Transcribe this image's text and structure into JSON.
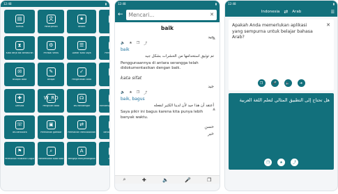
{
  "colors": {
    "accent": "#12707c"
  },
  "status": {
    "time": "12:48"
  },
  "grid": {
    "tiles": [
      {
        "label": "Kamus",
        "icon": "book-icon",
        "glyph": "▤"
      },
      {
        "label": "Penerjemah",
        "icon": "translate-icon",
        "glyph": "文"
      },
      {
        "label": "Favorit",
        "icon": "star-icon",
        "glyph": "★"
      },
      {
        "label": "",
        "icon": "blank-icon",
        "glyph": ""
      },
      {
        "label": "Frase",
        "icon": "phrase-icon",
        "glyph": "❝"
      },
      {
        "label": "Kata kerja tak beraturan",
        "icon": "hourglass-icon",
        "glyph": "⧗"
      },
      {
        "label": "Phrasal Verbs",
        "icon": "settings-icon",
        "glyph": "⚙"
      },
      {
        "label": "",
        "icon": "blank-icon",
        "glyph": ""
      },
      {
        "label": "Daftar Kata Saya",
        "icon": "list-icon",
        "glyph": "☰"
      },
      {
        "label": "Pemutar Audio",
        "icon": "audio-icon",
        "glyph": "♪"
      },
      {
        "label": "Bisapal Bata",
        "icon": "chat-icon",
        "glyph": "✉"
      },
      {
        "label": "",
        "icon": "blank-icon",
        "glyph": ""
      },
      {
        "label": "Belajar",
        "icon": "learn-icon",
        "glyph": "✎"
      },
      {
        "label": "Pengecekan Bata",
        "icon": "check-icon",
        "glyph": "✓"
      },
      {
        "label": "Tes",
        "icon": "test-icon",
        "glyph": "✐"
      },
      {
        "label": "",
        "icon": "blank-icon",
        "glyph": ""
      },
      {
        "label": "Genuda",
        "icon": "puzzle-icon",
        "glyph": "✚"
      },
      {
        "label": "Pengisian Bata",
        "icon": "fill-icon",
        "glyph": "W_RD"
      },
      {
        "label": "Tes Mendengar",
        "icon": "headphones-icon",
        "glyph": "☊"
      },
      {
        "label": "",
        "icon": "blank-icon",
        "glyph": ""
      },
      {
        "label": "Mendengarkan Memulis",
        "icon": "write-icon",
        "glyph": "✍"
      },
      {
        "label": "Tes berbicara",
        "icon": "speak-icon",
        "glyph": "☏"
      },
      {
        "label": "Permainan gambar",
        "icon": "image-icon",
        "glyph": "▣"
      },
      {
        "label": "",
        "icon": "blank-icon",
        "glyph": ""
      },
      {
        "label": "Permainan Mencocokkan",
        "icon": "match-icon",
        "glyph": "⇄"
      },
      {
        "label": "Benar atau salah",
        "icon": "truefalse-icon",
        "glyph": "✓✗"
      },
      {
        "label": "Permainan Mustahil Gugur",
        "icon": "flag-icon",
        "glyph": "⚑"
      },
      {
        "label": "",
        "icon": "blank-icon",
        "glyph": ""
      },
      {
        "label": "Menemukan Kata Kata",
        "icon": "search-word-icon",
        "glyph": "⌕"
      },
      {
        "label": "Mengeja menyenangkan",
        "icon": "spell-icon",
        "glyph": "A"
      },
      {
        "label": "Statistik",
        "icon": "stats-icon",
        "glyph": "▥"
      },
      {
        "label": "",
        "icon": "blank-icon",
        "glyph": ""
      }
    ]
  },
  "dictionary": {
    "search_placeholder": "Mencari...",
    "headword": "baik",
    "entries": [
      {
        "ar_word": "جيد",
        "trans": "baik",
        "ex_ar": "تم توثيق استخدامها من الحشرات بشكل جيد",
        "ex_id": "Penggunaannya di antara serangga telah didokumentasikan dengan baik."
      },
      {
        "pos": "kata sifat",
        "ar_word": "جيد",
        "trans": "baik, bagus",
        "ex_ar": "أعتقد أن هذا جيد لأن لدينا الكثير لنفعله",
        "ex_id": "Saya pikir ini bagus karena kita punya lebih banyak waktu."
      }
    ],
    "more_words": [
      "حسن",
      "خير"
    ]
  },
  "translator": {
    "source_lang": "Indonesia",
    "target_lang": "Arab",
    "source_text": "Apakah Anda memerlukan aplikasi yang sempurna untuk belajar bahasa Arab?",
    "target_text": "هل تحتاج إلى التطبيق المثالي لتعلم اللغة العربية"
  }
}
